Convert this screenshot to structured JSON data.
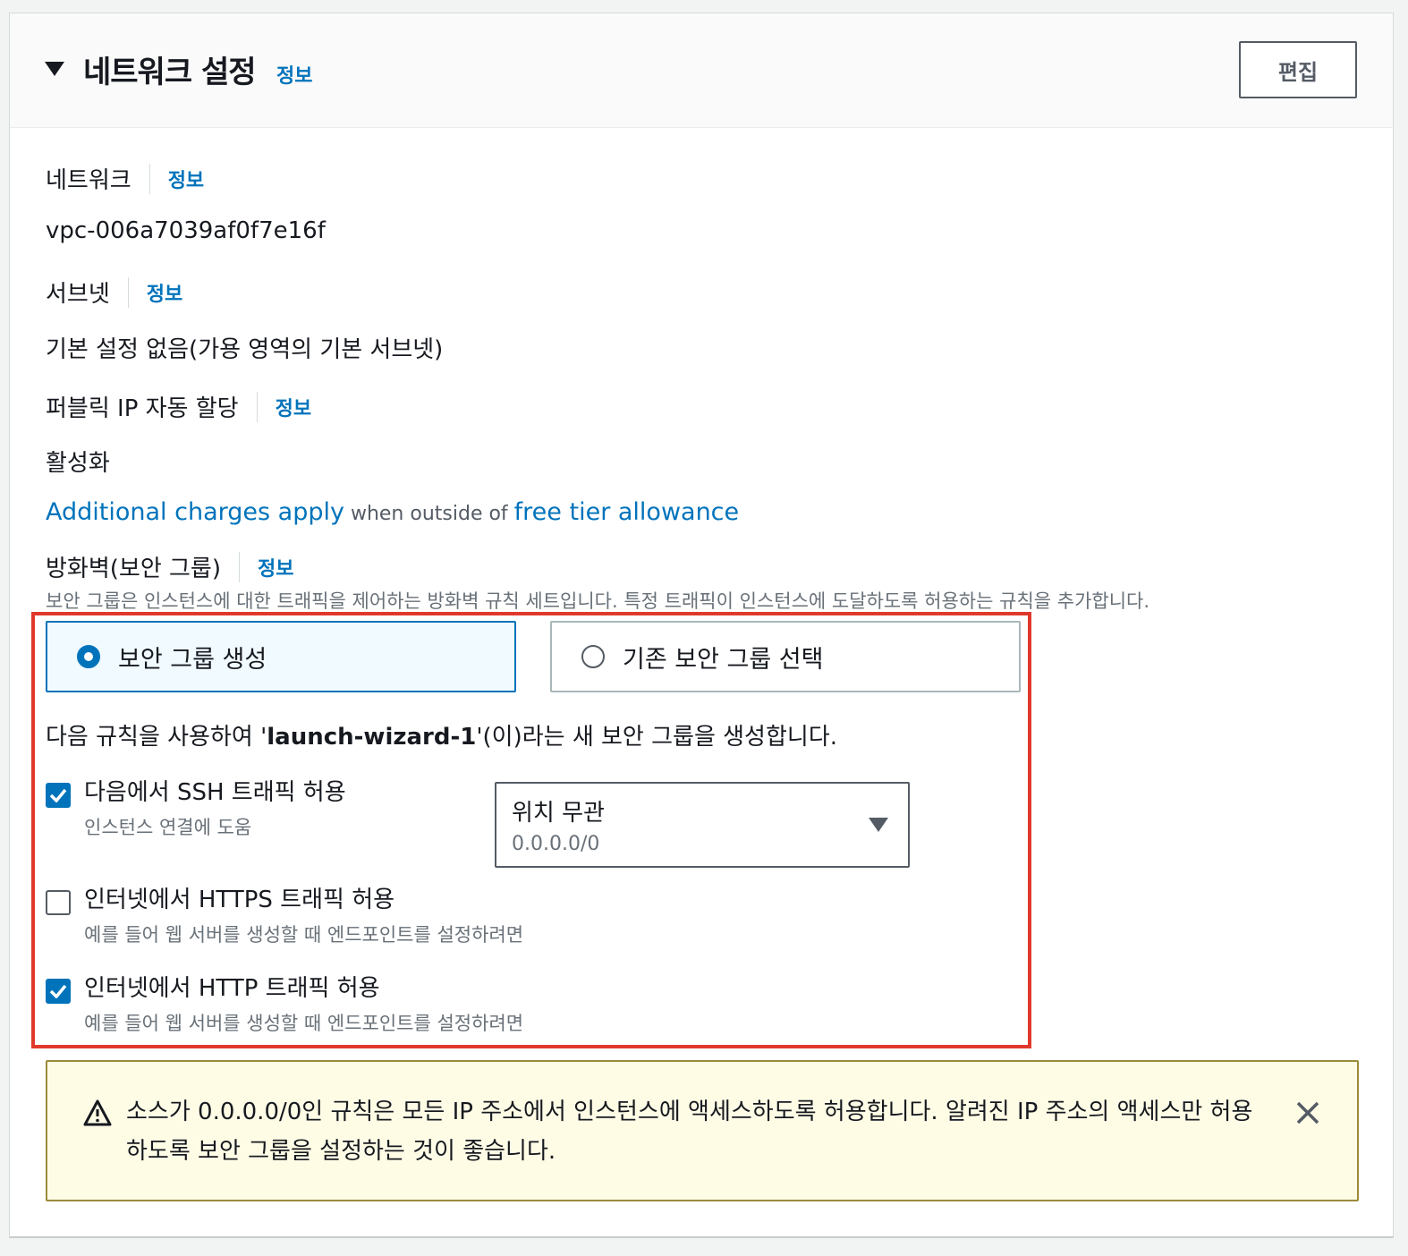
{
  "header": {
    "title": "네트워크 설정",
    "info": "정보",
    "edit_label": "편집"
  },
  "network": {
    "label": "네트워크",
    "info": "정보",
    "value": "vpc-006a7039af0f7e16f"
  },
  "subnet": {
    "label": "서브넷",
    "info": "정보",
    "value": "기본 설정 없음(가용 영역의 기본 서브넷)"
  },
  "public_ip": {
    "label": "퍼블릭 IP 자동 할당",
    "info": "정보",
    "value": "활성화"
  },
  "charges": {
    "link1": "Additional charges apply",
    "middle": " when outside of ",
    "link2": "free tier allowance"
  },
  "firewall": {
    "label": "방화벽(보안 그룹)",
    "info": "정보",
    "description": "보안 그룹은 인스턴스에 대한 트래픽을 제어하는 방화벽 규칙 세트입니다. 특정 트래픽이 인스턴스에 도달하도록 허용하는 규칙을 추가합니다.",
    "options": [
      {
        "label": "보안 그룹 생성",
        "selected": true
      },
      {
        "label": "기존 보안 그룹 선택",
        "selected": false
      }
    ],
    "rule_desc_prefix": "다음 규칙을 사용하여 '",
    "group_name": "launch-wizard-1",
    "rule_desc_suffix": "'(이)라는 새 보안 그룹을 생성합니다."
  },
  "rules": [
    {
      "label": "다음에서 SSH 트래픽 허용",
      "sub": "인스턴스 연결에 도움",
      "checked": true
    },
    {
      "label": "인터넷에서 HTTPS 트래픽 허용",
      "sub": "예를 들어 웹 서버를 생성할 때 엔드포인트를 설정하려면",
      "checked": false
    },
    {
      "label": "인터넷에서 HTTP 트래픽 허용",
      "sub": "예를 들어 웹 서버를 생성할 때 엔드포인트를 설정하려면",
      "checked": true
    }
  ],
  "ssh_source": {
    "value": "위치 무관",
    "description": "0.0.0.0/0"
  },
  "warning": {
    "text": "소스가 0.0.0.0/0인 규칙은 모든 IP 주소에서 인스턴스에 액세스하도록 허용합니다. 알려진 IP 주소의 액세스만 허용하도록 보안 그룹을 설정하는 것이 좋습니다."
  },
  "colors": {
    "link": "#0073bb",
    "highlight_border": "#e0392b",
    "warning_bg": "#fffce6"
  }
}
